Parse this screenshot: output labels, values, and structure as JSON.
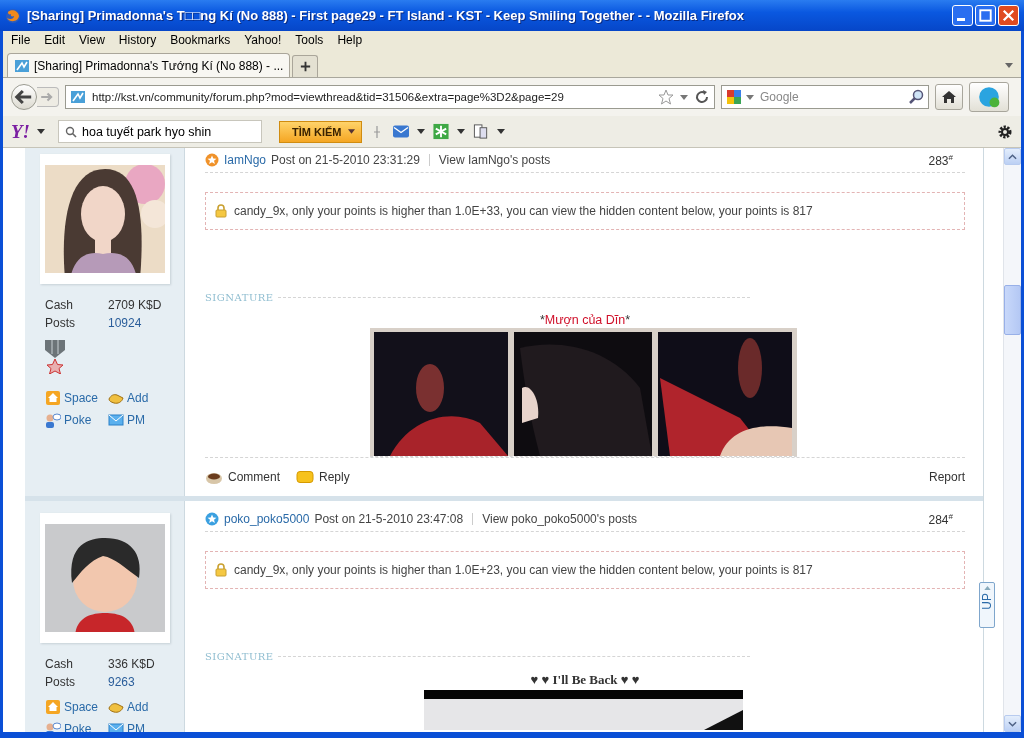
{
  "window": {
    "title": "[Sharing] Primadonna's T□□ng Kí (No 888) - First page29 - FT Island - KST - Keep Smiling Together - - Mozilla Firefox"
  },
  "menu": [
    "File",
    "Edit",
    "View",
    "History",
    "Bookmarks",
    "Yahoo!",
    "Tools",
    "Help"
  ],
  "tabs": [
    {
      "label": "[Sharing] Primadonna's Tướng Kí (No 888) - ...",
      "selected": true
    }
  ],
  "address": {
    "value": "http://kst.vn/community/forum.php?mod=viewthread&tid=31506&extra=page%3D2&page=29"
  },
  "search": {
    "placeholder": "Google"
  },
  "yahoo_toolbar": {
    "logo": "Y!",
    "search_value": "hoa tuyết park hyo shin",
    "button": "TÌM KIẾM"
  },
  "posts": [
    {
      "author": "IamNgo",
      "posted": "Post on 21-5-2010 23:31:29",
      "view_link": "View IamNgo's posts",
      "number": "283$^{#}$",
      "color": "#f0922a",
      "stats": [
        {
          "label": "Cash",
          "value": "2709 K$D",
          "link": false
        },
        {
          "label": "Posts",
          "value": "10924",
          "link": true
        }
      ],
      "medal": true,
      "actions": [
        {
          "kind": "space",
          "label": "Space"
        },
        {
          "kind": "add",
          "label": "Add"
        },
        {
          "kind": "poke",
          "label": "Poke"
        },
        {
          "kind": "pm",
          "label": "PM"
        }
      ],
      "locked": "candy_9x, only your points is higher than 1.0E+33, you can view the hidden content below, your points is 817",
      "signature_label": "SIGNATURE",
      "signature_title": [
        {
          "text": "*",
          "emphasis": false
        },
        {
          "text": "Mượn của Dĩn",
          "emphasis": true
        },
        {
          "text": "*",
          "emphasis": false
        }
      ],
      "title_bold": false,
      "footer": [
        {
          "kind": "comment",
          "label": "Comment"
        },
        {
          "kind": "reply",
          "label": "Reply"
        }
      ],
      "report": "Report"
    },
    {
      "author": "poko_poko5000",
      "posted": "Post on 21-5-2010 23:47:08",
      "view_link": "View poko_poko5000's posts",
      "number": "284$^{#}$",
      "color": "#3ba0e0",
      "stats": [
        {
          "label": "Cash",
          "value": "336 K$D",
          "link": false
        },
        {
          "label": "Posts",
          "value": "9263",
          "link": true
        }
      ],
      "medal": false,
      "actions": [
        {
          "kind": "space",
          "label": "Space"
        },
        {
          "kind": "add",
          "label": "Add"
        },
        {
          "kind": "poke",
          "label": "Poke"
        },
        {
          "kind": "pm",
          "label": "PM"
        }
      ],
      "locked": "candy_9x, only your points is higher than 1.0E+23, you can view the hidden content below, your points is 817",
      "signature_label": "SIGNATURE",
      "signature_title": [
        {
          "text": "♥ ♥ I'll Be Back ♥ ♥",
          "emphasis": false
        }
      ],
      "title_bold": true
    }
  ],
  "up_button": {
    "label": "UP"
  }
}
